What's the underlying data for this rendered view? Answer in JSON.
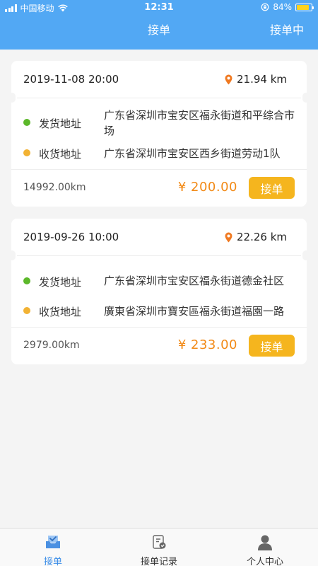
{
  "status_bar": {
    "carrier": "中国移动",
    "time": "12:31",
    "battery": "84%",
    "battery_level": 0.84,
    "battery_color": "#ffd21f"
  },
  "nav": {
    "title": "接单",
    "right_label": "接单中",
    "bg_color": "#52a8f4"
  },
  "orders": [
    {
      "datetime": "2019-11-08 20:00",
      "distance": "21.94 km",
      "pickup_label": "发货地址",
      "pickup_address": "广东省深圳市宝安区福永街道和平综合市场",
      "dropoff_label": "收货地址",
      "dropoff_address": "广东省深圳市宝安区西乡街道劳动1队",
      "km": "14992.00km",
      "price": "¥ 200.00",
      "button": "接单"
    },
    {
      "datetime": "2019-09-26 10:00",
      "distance": "22.26 km",
      "pickup_label": "发货地址",
      "pickup_address": "广东省深圳市宝安区福永街道德金社区",
      "dropoff_label": "收货地址",
      "dropoff_address": "廣東省深圳市寶安區福永街道福園一路",
      "km": "2979.00km",
      "price": "¥ 233.00",
      "button": "接单"
    }
  ],
  "tabbar": {
    "tabs": [
      {
        "label": "接单",
        "icon": "inbox-check-icon",
        "active": true
      },
      {
        "label": "接单记录",
        "icon": "clipboard-check-icon",
        "active": false
      },
      {
        "label": "个人中心",
        "icon": "person-icon",
        "active": false
      }
    ]
  },
  "colors": {
    "pickup_dot": "#5cb82a",
    "dropoff_dot": "#f2b233",
    "price": "#f28a17",
    "button": "#f5b51e",
    "active_tab": "#3d8ee8"
  }
}
